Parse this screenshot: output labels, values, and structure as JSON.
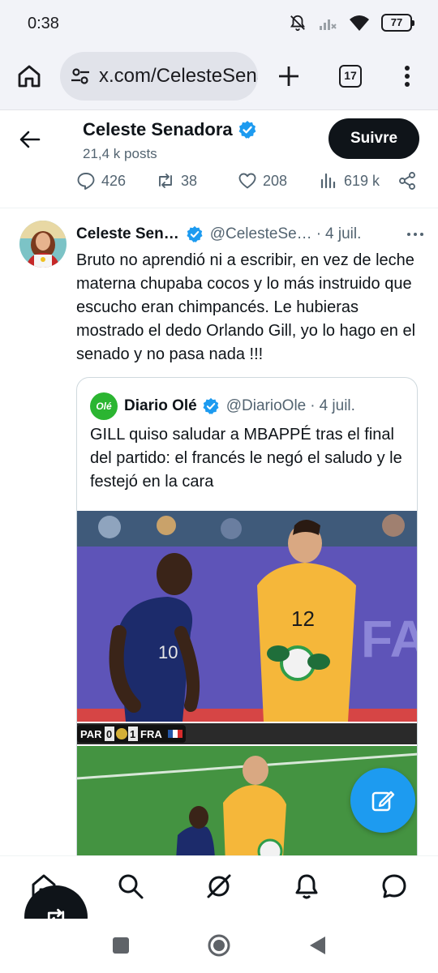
{
  "status_bar": {
    "time": "0:38",
    "battery": "77",
    "icons": [
      "bell-off-icon",
      "signal-icon",
      "wifi-icon",
      "battery-icon"
    ]
  },
  "browser": {
    "url": "x.com/CelesteSenadora",
    "tab_count": "17",
    "icons": [
      "home-icon",
      "site-settings-icon",
      "new-tab-plus-icon",
      "tabs-icon",
      "more-vertical-icon"
    ]
  },
  "profile_header": {
    "name": "Celeste Senadora",
    "posts": "21,4 k posts",
    "follow_label": "Suivre",
    "stats": {
      "replies": "426",
      "reposts": "38",
      "likes": "208",
      "views": "619 k"
    }
  },
  "tweet": {
    "author_name": "Celeste Sen…",
    "author_handle": "@CelesteSe…",
    "separator": "·",
    "date": "4 juil.",
    "text": "Bruto no aprendió ni a escribir, en vez de leche materna chupaba cocos y lo más instruido que escucho eran chimpancés. Le hubieras mostrado el dedo Orlando Gill, yo lo hago en el senado y no pasa nada  !!!",
    "quoted": {
      "name": "Diario Olé",
      "handle": "@DiarioOle",
      "separator": "·",
      "date": "4 juil.",
      "logo_text": "Olé",
      "text": "GILL quiso saludar a MBAPPÉ tras el final del partido: el francés le negó el saludo y le festejó en la cara",
      "scoreboard": {
        "home": "PAR",
        "home_score": "0",
        "away_score": "1",
        "away": "FRA"
      },
      "media_jersey_numbers": [
        "10",
        "12"
      ],
      "media_banner_text": "FA"
    }
  },
  "colors": {
    "accent": "#1d9bf0",
    "text": "#0f1419",
    "muted": "#536471",
    "verified": "#1d9bf0",
    "ole_green": "#2bb531"
  },
  "bottom_nav": [
    "home-icon",
    "search-icon",
    "grok-icon",
    "notifications-icon",
    "messages-icon"
  ]
}
